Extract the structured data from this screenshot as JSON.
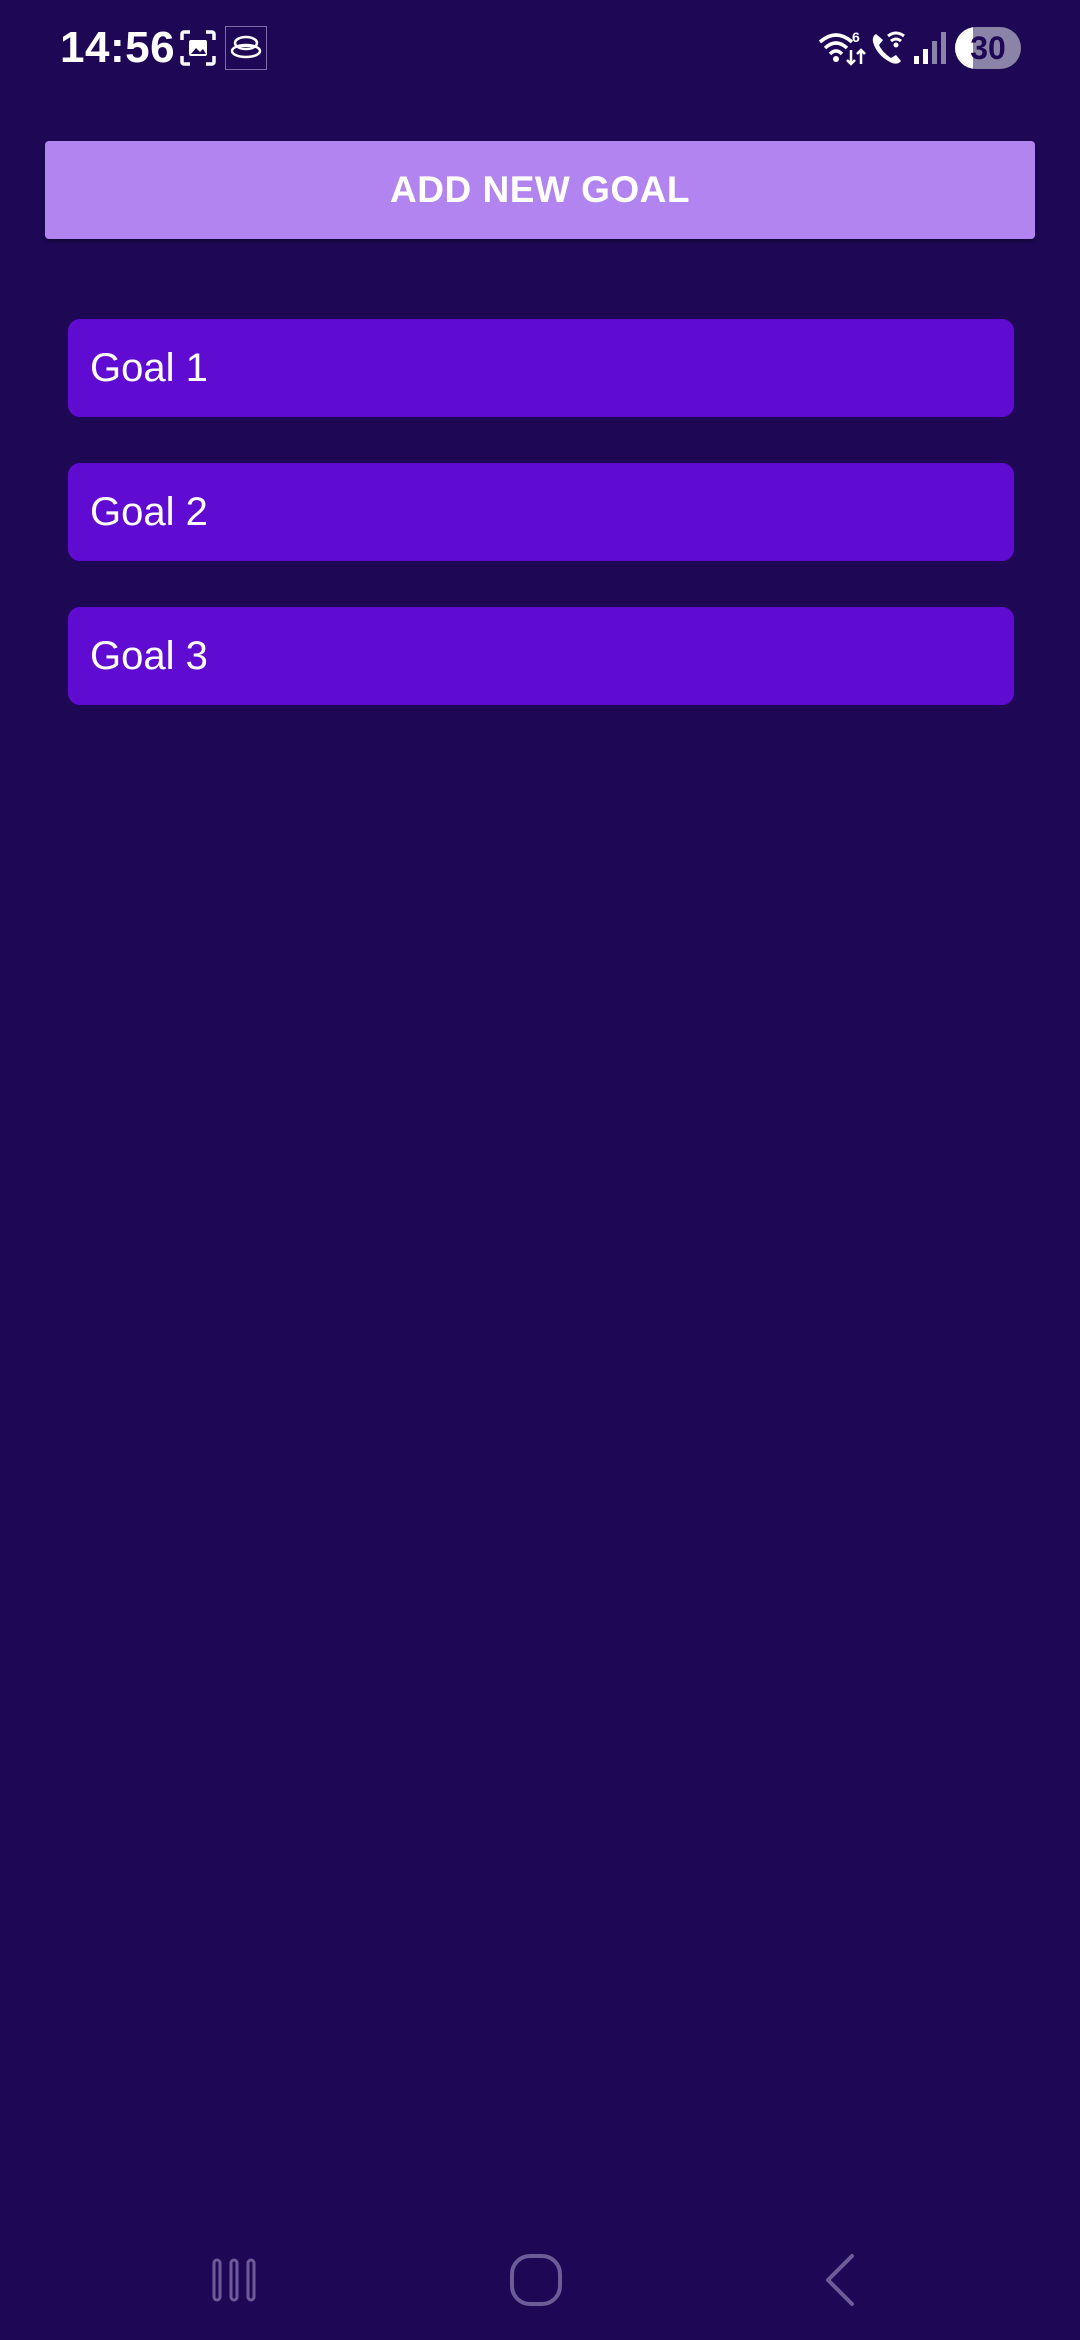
{
  "status_bar": {
    "time": "14:56",
    "battery_level": "30",
    "icons": [
      "screenshot-icon",
      "app-notification-icon",
      "wifi-6-icon",
      "wifi-calling-icon",
      "cellular-signal-icon",
      "battery-icon"
    ]
  },
  "actions": {
    "add_goal_label": "ADD NEW GOAL"
  },
  "goals": [
    {
      "label": "Goal 1"
    },
    {
      "label": "Goal 2"
    },
    {
      "label": "Goal 3"
    }
  ],
  "navigation": {
    "buttons": [
      "recent-apps-icon",
      "home-icon",
      "back-icon"
    ]
  },
  "colors": {
    "background": "#1e0856",
    "add_button": "#b284f0",
    "goal_item": "#5f0bd2",
    "text": "#ffffff"
  }
}
